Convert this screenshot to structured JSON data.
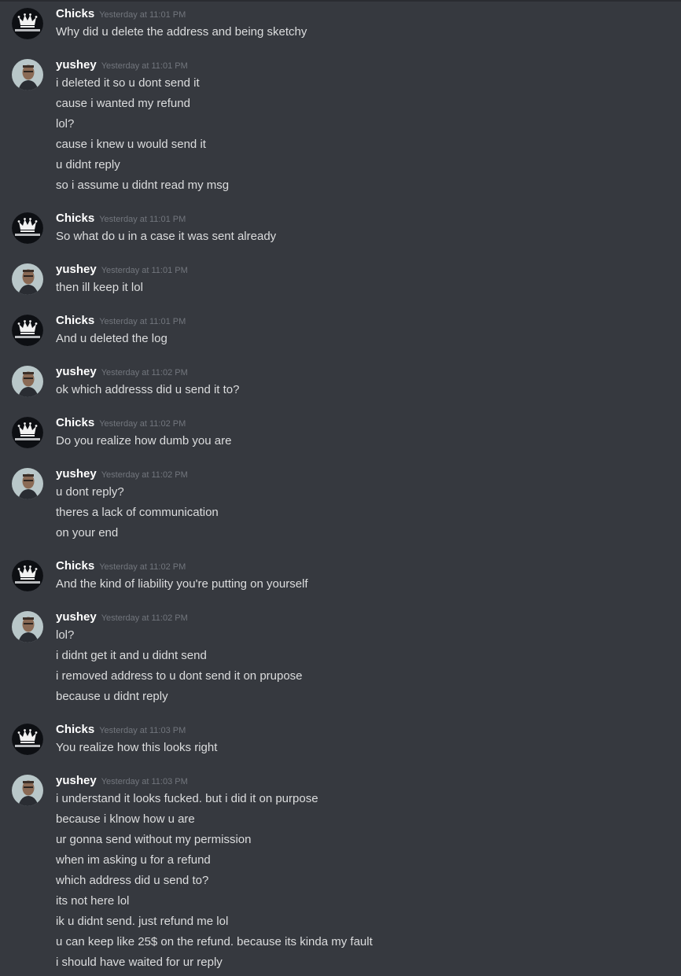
{
  "users": {
    "chicks": {
      "name": "Chicks",
      "avatar_icon": "crown-logo-icon"
    },
    "yushey": {
      "name": "yushey",
      "avatar_icon": "user-photo-icon"
    }
  },
  "messages": [
    {
      "author": "Chicks",
      "timestamp": "Yesterday at 11:01 PM",
      "lines": [
        "Why did u delete the address and being sketchy"
      ]
    },
    {
      "author": "yushey",
      "timestamp": "Yesterday at 11:01 PM",
      "lines": [
        "i deleted it so u dont send it",
        "cause i wanted my refund",
        "lol?",
        "cause i knew u would send it",
        "u didnt reply",
        "so i assume u didnt read my msg"
      ]
    },
    {
      "author": "Chicks",
      "timestamp": "Yesterday at 11:01 PM",
      "lines": [
        "So what do u in a case it was sent already"
      ]
    },
    {
      "author": "yushey",
      "timestamp": "Yesterday at 11:01 PM",
      "lines": [
        "then ill keep it lol"
      ]
    },
    {
      "author": "Chicks",
      "timestamp": "Yesterday at 11:01 PM",
      "lines": [
        "And u deleted the log"
      ]
    },
    {
      "author": "yushey",
      "timestamp": "Yesterday at 11:02 PM",
      "lines": [
        "ok which addresss did u send it to?"
      ]
    },
    {
      "author": "Chicks",
      "timestamp": "Yesterday at 11:02 PM",
      "lines": [
        "Do you realize how dumb you are"
      ]
    },
    {
      "author": "yushey",
      "timestamp": "Yesterday at 11:02 PM",
      "lines": [
        "u dont reply?",
        "theres a lack of communication",
        "on your end"
      ]
    },
    {
      "author": "Chicks",
      "timestamp": "Yesterday at 11:02 PM",
      "lines": [
        "And the kind of liability you're putting on yourself"
      ]
    },
    {
      "author": "yushey",
      "timestamp": "Yesterday at 11:02 PM",
      "lines": [
        "lol?",
        "i didnt get it and u didnt send",
        "i removed address to u dont send it on prupose",
        "because u didnt reply"
      ]
    },
    {
      "author": "Chicks",
      "timestamp": "Yesterday at 11:03 PM",
      "lines": [
        "You realize how this looks right"
      ]
    },
    {
      "author": "yushey",
      "timestamp": "Yesterday at 11:03 PM",
      "lines": [
        "i understand it looks fucked. but i did it on purpose",
        "because i klnow how u are",
        "ur gonna send without my permission",
        "when im asking u for a refund",
        "which address did u send to?",
        "its not here lol",
        "ik u didnt send. just refund me lol",
        "u can keep like 25$ on the refund. because its kinda my fault",
        "i should have waited for ur reply"
      ]
    }
  ]
}
